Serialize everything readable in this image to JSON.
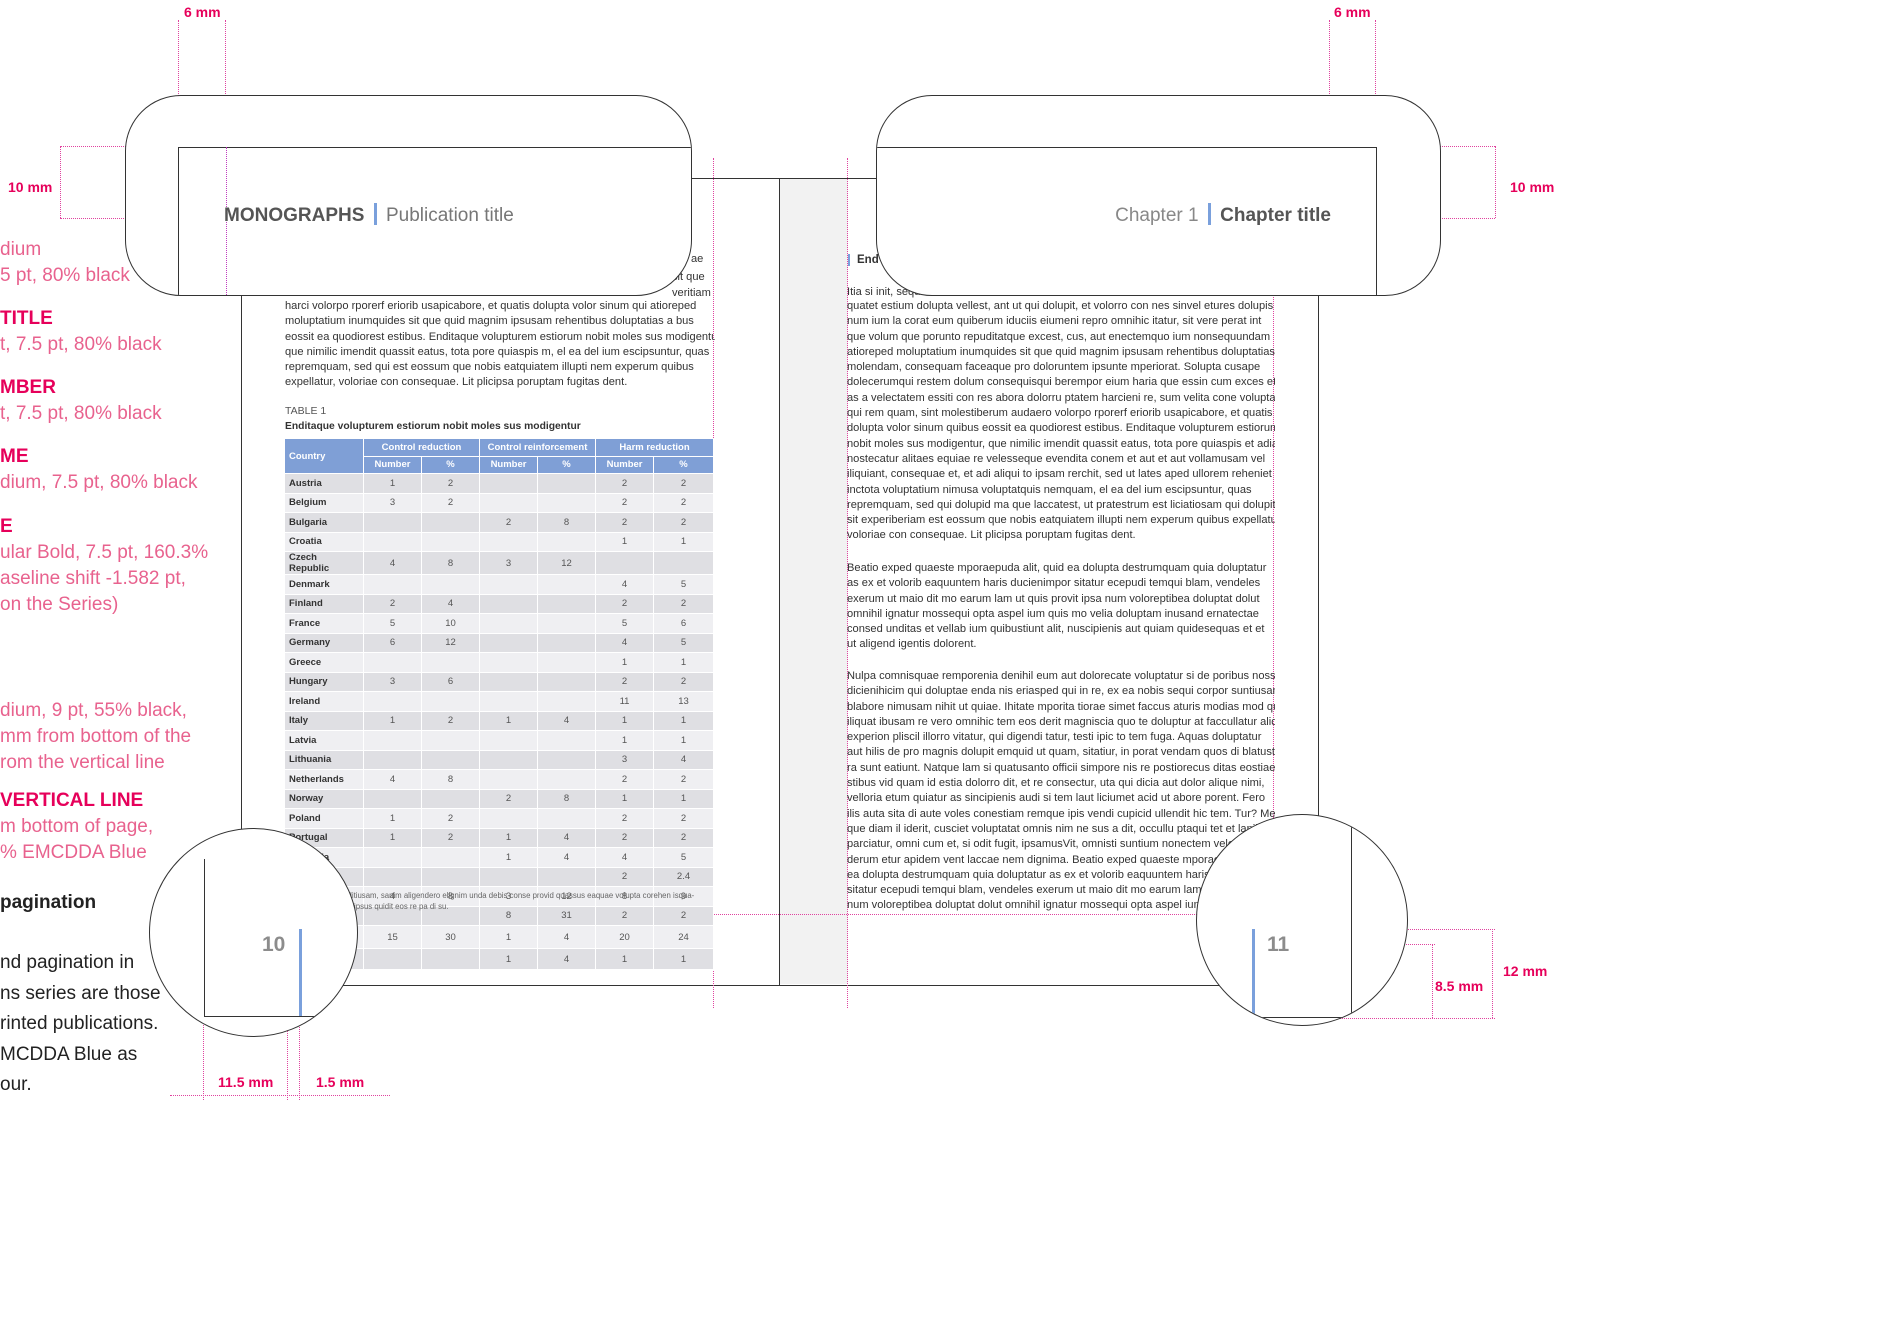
{
  "dimensions": {
    "top_left": "6 mm",
    "top_right": "6 mm",
    "left_margin": "10 mm",
    "right_margin": "10 mm",
    "bottom_left": "11.5 mm",
    "bottom_left_small": "1.5 mm",
    "bottom_right_inner": "8.5 mm",
    "bottom_right_outer": "12 mm"
  },
  "specs": [
    {
      "heading": "",
      "text": [
        "dium",
        "5 pt, 80% black"
      ]
    },
    {
      "heading": "TITLE",
      "text": [
        "t, 7.5 pt, 80% black"
      ]
    },
    {
      "heading": "MBER",
      "text": [
        "t, 7.5 pt, 80% black"
      ]
    },
    {
      "heading": "ME",
      "text": [
        "dium, 7.5 pt, 80% black"
      ]
    },
    {
      "heading": "E",
      "text": [
        "ular Bold, 7.5 pt, 160.3%",
        "aseline shift -1.582 pt,",
        "on the Series)"
      ]
    },
    {
      "heading": "",
      "text": [
        "dium, 9 pt, 55% black,",
        "mm from bottom of the",
        "rom the vertical line"
      ]
    },
    {
      "heading": "VERTICAL LINE",
      "text": [
        "m bottom of page,",
        "% EMCDDA Blue"
      ]
    }
  ],
  "pagination": {
    "heading": "pagination",
    "lines": [
      "nd pagination in",
      "ns series are those",
      "rinted publications.",
      "MCDDA Blue as",
      "our."
    ]
  },
  "header_left": {
    "series": "MONOGRAPHS",
    "title": "Publication title"
  },
  "header_right": {
    "chapter": "Chapter 1",
    "title": "Chapter title"
  },
  "left_page": {
    "fragment_a": "ae",
    "fragment_b": "sit que",
    "fragment_c": "veritiam",
    "paragraph": [
      "harci volorpo rporerf eriorib usapicabore, et quatis dolupta volor sinum qui atioreped",
      "moluptatium inumquides sit que quid magnim ipsusam rehentibus doluptatias a bus",
      "eossit ea quodiorest estibus. Enditaque volupturem estiorum nobit moles sus modigentur,",
      "que nimilic imendit quassit eatus, tota pore quiaspis m, el ea del ium escipsuntur, quas",
      "repremquam, sed qui est eossum que nobis eatquiatem illupti nem experum quibus",
      "expellatur, voloriae con consequae. Lit plicipsa poruptam fugitas dent."
    ],
    "table_label": "TABLE 1",
    "table_title": "Enditaque volupturem estiorum nobit moles sus modigentur",
    "table_groups": [
      "Control reduction",
      "Control reinforcement",
      "Harm reduction"
    ],
    "table_country": "Country",
    "table_sub": [
      "Number",
      "%",
      "Number",
      "%",
      "Number",
      "%"
    ],
    "table_rows": [
      [
        "Austria",
        "1",
        "2",
        "",
        "",
        "2",
        "2"
      ],
      [
        "Belgium",
        "3",
        "2",
        "",
        "",
        "2",
        "2"
      ],
      [
        "Bulgaria",
        "",
        "",
        "2",
        "8",
        "2",
        "2"
      ],
      [
        "Croatia",
        "",
        "",
        "",
        "",
        "1",
        "1"
      ],
      [
        "Czech Republic",
        "4",
        "8",
        "3",
        "12",
        "",
        ""
      ],
      [
        "Denmark",
        "",
        "",
        "",
        "",
        "4",
        "5"
      ],
      [
        "Finland",
        "2",
        "4",
        "",
        "",
        "2",
        "2"
      ],
      [
        "France",
        "5",
        "10",
        "",
        "",
        "5",
        "6"
      ],
      [
        "Germany",
        "6",
        "12",
        "",
        "",
        "4",
        "5"
      ],
      [
        "Greece",
        "",
        "",
        "",
        "",
        "1",
        "1"
      ],
      [
        "Hungary",
        "3",
        "6",
        "",
        "",
        "2",
        "2"
      ],
      [
        "Ireland",
        "",
        "",
        "",
        "",
        "11",
        "13"
      ],
      [
        "Italy",
        "1",
        "2",
        "1",
        "4",
        "1",
        "1"
      ],
      [
        "Latvia",
        "",
        "",
        "",
        "",
        "1",
        "1"
      ],
      [
        "Lithuania",
        "",
        "",
        "",
        "",
        "3",
        "4"
      ],
      [
        "Netherlands",
        "4",
        "8",
        "",
        "",
        "2",
        "2"
      ],
      [
        "Norway",
        "",
        "",
        "2",
        "8",
        "1",
        "1"
      ],
      [
        "Poland",
        "1",
        "2",
        "",
        "",
        "2",
        "2"
      ],
      [
        "Portugal",
        "1",
        "2",
        "1",
        "4",
        "2",
        "2"
      ],
      [
        "Romania",
        "",
        "",
        "1",
        "4",
        "4",
        "5"
      ],
      [
        "Slovenia",
        "",
        "",
        "",
        "",
        "2",
        "2.4"
      ],
      [
        "Spain",
        "4",
        "8",
        "3",
        "12",
        "8",
        "9"
      ],
      [
        "Sweden",
        "",
        "",
        "8",
        "31",
        "2",
        "2"
      ],
      [
        "United Kingdom",
        "15",
        "30",
        "1",
        "4",
        "20",
        "24"
      ],
      [
        "Non country\nspecific",
        "",
        "",
        "1",
        "4",
        "1",
        "1"
      ]
    ],
    "footnote_1": "a ditiusam, sanim aligendero elignim unda debis conse provid quassus eaquae volupta corehen isqua-",
    "footnote_2": "um ipsus quidit eos re pa di su.",
    "page_number": "10"
  },
  "right_page": {
    "heading_fragment": "End",
    "line_first": "Itia si init, sequ",
    "para1": [
      "quatet estium dolupta vellest, ant ut qui dolupit, et volorro con nes sinvel etures dolupis",
      "num ium la corat eum quiberum iduciis eiumeni repro omnihic itatur, sit vere perat int",
      "que volum que porunto repuditatque excest, cus, aut enectemquo ium nonsequundam",
      "atioreped moluptatium inumquides sit que quid magnim ipsusam rehentibus doluptatias",
      "molendam, consequam faceaque pro doloruntem ipsunte mperiorat. Solupta cusape",
      "dolecerumqui restem dolum consequisqui berempor eium haria que essin cum exces et",
      "as a velectatem essiti con res abora dolorru ptatem harcieni re, sum velita cone voluptas",
      "qui rem quam, sint molestiberum audaero volorpo rporerf eriorib usapicabore, et quatis",
      "dolupta volor sinum quibus eossit ea quodiorest estibus. Enditaque volupturem estiorum",
      "nobit moles sus modigentur, que nimilic imendit quassit eatus, tota pore quiaspis et adiate",
      "nostecatur alitaes equiae re velesseque evendita conem et aut et aut vollamusam vel",
      "iliquiant, consequae et, et adi aliqui to ipsam rerchit, sed ut lates aped ullorem reheniet",
      "inctota voluptatium nimusa voluptatquis nemquam, el ea del ium escipsuntur, quas",
      "repremquam, sed qui dolupid ma que laccatest, ut pratestrum est liciatiosam qui dolupitam",
      "sit experiberiam est eossum que nobis eatquiatem illupti nem experum quibus expellatur,",
      "voloriae con consequae. Lit plicipsa poruptam fugitas dent."
    ],
    "para2": [
      "Beatio exped quaeste mporaepuda alit, quid ea dolupta destrumquam quia doluptatur",
      "as ex et volorib eaquuntem haris ducienimpor sitatur ecepudi temqui blam, vendeles",
      "exerum ut maio dit mo earum lam ut quis provit ipsa num voloreptibea doluptat dolut",
      "omnihil ignatur mossequi opta aspel ium quis mo velia doluptam inusand ernatectae",
      "consed unditas et vellab ium quibustiunt alit, nuscipienis aut quiam quidesequas et et",
      "ut aligend igentis dolorent."
    ],
    "para3": [
      "Nulpa comnisquae remporenia denihil eum aut dolorecate voluptatur si de poribus nossit",
      "dicienihicim qui doluptae enda nis eriasped qui in re, ex ea nobis sequi corpor suntiusam si",
      "blabore nimusam nihit ut quiae. Ihitate mporita tiorae simet faccus aturis modias mod quia",
      "iliquat ibusam re vero omnihic tem eos derit magniscia quo te doluptur at faccullatur aliquo",
      "experion pliscil illorro vitatur, qui digendi tatur, testi ipic to tem fuga. Aquas doluptatur",
      "aut hilis de pro magnis dolupit emquid ut quam, sitatiur, in porat vendam quos di blatust",
      "ra sunt eatiunt. Natque lam si quatusanto officii simpore nis re postiorecus ditas eostiae",
      "stibus vid quam id estia dolorro dit, et re consectur, uta qui dicia aut dolor alique nimi,",
      "velloria etum quiatur as sincipienis audi si tem laut liciumet acid ut abore porent. Fero",
      "ilis auta sita di aute voles conestiam remque ipis vendi cupicid ullendit hic tem. Tur? Met",
      "que diam il iderit, cusciet voluptatat omnis nim ne sus a dit, occullu ptaqui tet et lanihitate",
      "parciatur, omni cum et, si odit fugit, ipsamusVit, omnisti suntium nonectem velessinis",
      "derum etur apidem vent laccae nem dignima. Beatio exped quaeste mporaepuda alit, quid",
      "ea dolupta destrumquam quia doluptatur as ex et volorib eaquuntem haris ducienim",
      "sitatur ecepudi temqui blam, vendeles exerum ut maio dit mo earum lam ut quis",
      "num voloreptibea doluptat dolut omnihil ignatur mossequi opta aspel ium quis"
    ],
    "page_number": "11"
  },
  "colors": {
    "accent_blue": "#7aa0dc",
    "guide_pink": "#e6005a"
  }
}
